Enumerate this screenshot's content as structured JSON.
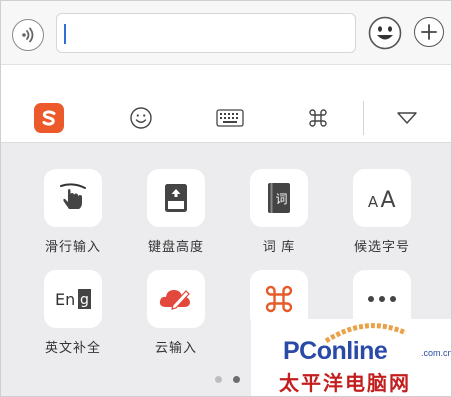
{
  "input_bar": {
    "voice_icon": "voice-waves-icon",
    "text_value": "",
    "emoji_icon": "smiley-face-icon",
    "plus_icon": "plus-icon"
  },
  "toolbar": {
    "items": [
      {
        "name": "sogou-logo",
        "icon": "sogou-s-logo"
      },
      {
        "name": "emoji",
        "icon": "smiley-outline-icon"
      },
      {
        "name": "keyboard",
        "icon": "keyboard-icon"
      },
      {
        "name": "command",
        "icon": "command-key-icon"
      },
      {
        "name": "collapse",
        "icon": "triangle-down-icon"
      }
    ]
  },
  "grid": {
    "items": [
      {
        "label": "滑行输入",
        "icon": "swipe-hand-icon"
      },
      {
        "label": "键盘高度",
        "icon": "keyboard-height-icon"
      },
      {
        "label": "词 库",
        "icon": "dictionary-book-icon",
        "glyph": "词"
      },
      {
        "label": "候选字号",
        "icon": "font-size-icon",
        "glyph": "AA"
      },
      {
        "label": "英文补全",
        "icon": "english-complete-icon",
        "glyph": "Eng"
      },
      {
        "label": "云输入",
        "icon": "cloud-pen-icon"
      },
      {
        "label": "",
        "icon": "command-key-orange-icon"
      },
      {
        "label": "",
        "icon": "more-dots-icon"
      }
    ]
  },
  "pager": {
    "pages": 2,
    "current": 2
  },
  "watermark": {
    "brand": "PConline",
    "domain": ".com.cn",
    "chinese": "太平洋电脑网"
  },
  "colors": {
    "accent": "#ec5a2b",
    "caret": "#2f6fd6",
    "panel_bg": "#ececee",
    "watermark_blue": "#2a4aa8",
    "watermark_red": "#c41f1f"
  }
}
